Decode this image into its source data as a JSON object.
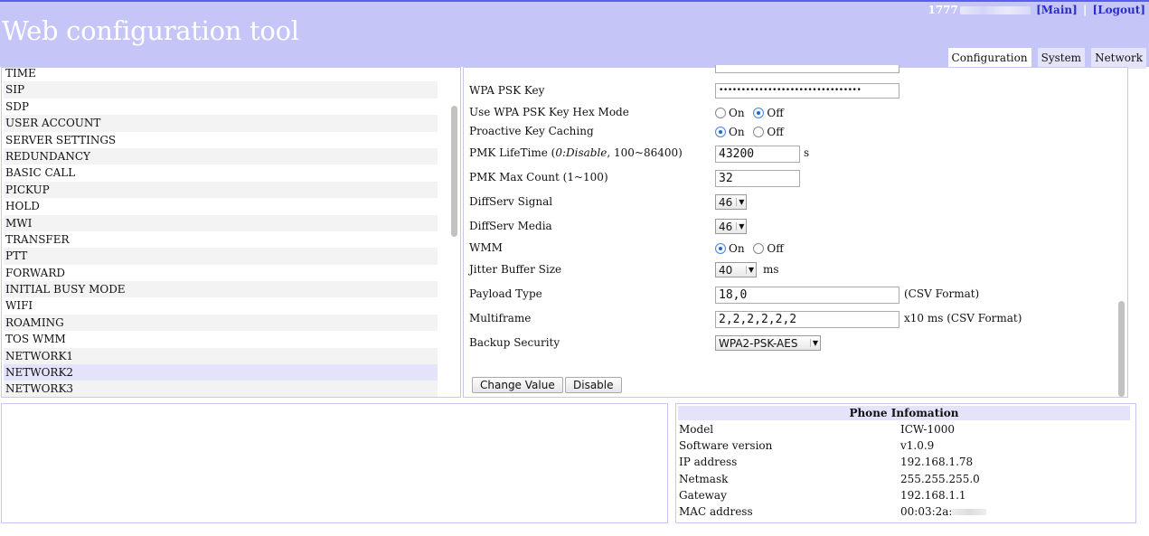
{
  "header": {
    "title": "Web configuration tool",
    "user": "1777",
    "links": {
      "main": "[Main]",
      "logout": "[Logout]",
      "separator": "|"
    },
    "tabs": [
      "Configuration",
      "System",
      "Network"
    ],
    "active_tab": "Configuration"
  },
  "sidebar": {
    "items": [
      {
        "label": "TIME"
      },
      {
        "label": "SIP"
      },
      {
        "label": "SDP"
      },
      {
        "label": "USER ACCOUNT"
      },
      {
        "label": "SERVER SETTINGS"
      },
      {
        "label": "REDUNDANCY"
      },
      {
        "label": "BASIC CALL"
      },
      {
        "label": "PICKUP"
      },
      {
        "label": "HOLD"
      },
      {
        "label": "MWI"
      },
      {
        "label": "TRANSFER"
      },
      {
        "label": "PTT"
      },
      {
        "label": "FORWARD"
      },
      {
        "label": "INITIAL BUSY MODE"
      },
      {
        "label": "WIFI"
      },
      {
        "label": "ROAMING"
      },
      {
        "label": "TOS WMM"
      },
      {
        "label": "NETWORK1"
      },
      {
        "label": "NETWORK2"
      },
      {
        "label": "NETWORK3"
      }
    ],
    "selected": "NETWORK2"
  },
  "form": {
    "wpa_psk_key": {
      "label": "WPA PSK Key",
      "value": "••••••••••••••••••••••••••••••••"
    },
    "hex_mode": {
      "label": "Use WPA PSK Key Hex Mode",
      "on": "On",
      "off": "Off",
      "selected": "Off"
    },
    "key_caching": {
      "label": "Proactive Key Caching",
      "on": "On",
      "off": "Off",
      "selected": "On"
    },
    "pmk_lifetime": {
      "label_pre": "PMK LifeTime (",
      "label_em": "0:Disable",
      "label_post": ", 100~86400)",
      "value": "43200",
      "unit": "s"
    },
    "pmk_max_count": {
      "label": "PMK Max Count (1~100)",
      "value": "32"
    },
    "diffserv_signal": {
      "label": "DiffServ Signal",
      "value": "46"
    },
    "diffserv_media": {
      "label": "DiffServ Media",
      "value": "46"
    },
    "wmm": {
      "label": "WMM",
      "on": "On",
      "off": "Off",
      "selected": "On"
    },
    "jitter_buffer": {
      "label": "Jitter Buffer Size",
      "value": "40",
      "unit": "ms"
    },
    "payload_type": {
      "label": "Payload Type",
      "value": "18,0",
      "note": "(CSV Format)"
    },
    "multiframe": {
      "label": "Multiframe",
      "value": "2,2,2,2,2,2",
      "note": "x10 ms (CSV Format)"
    },
    "backup_security": {
      "label": "Backup Security",
      "value": "WPA2-PSK-AES"
    },
    "buttons": {
      "change": "Change Value",
      "disable": "Disable"
    }
  },
  "phone_info": {
    "title": "Phone Infomation",
    "rows": [
      {
        "key": "Model",
        "value": "ICW-1000"
      },
      {
        "key": "Software version",
        "value": "v1.0.9"
      },
      {
        "key": "IP address",
        "value": "192.168.1.78"
      },
      {
        "key": "Netmask",
        "value": "255.255.255.0"
      },
      {
        "key": "Gateway",
        "value": "192.168.1.1"
      },
      {
        "key": "MAC address",
        "value": "00:03:2a:"
      }
    ]
  }
}
